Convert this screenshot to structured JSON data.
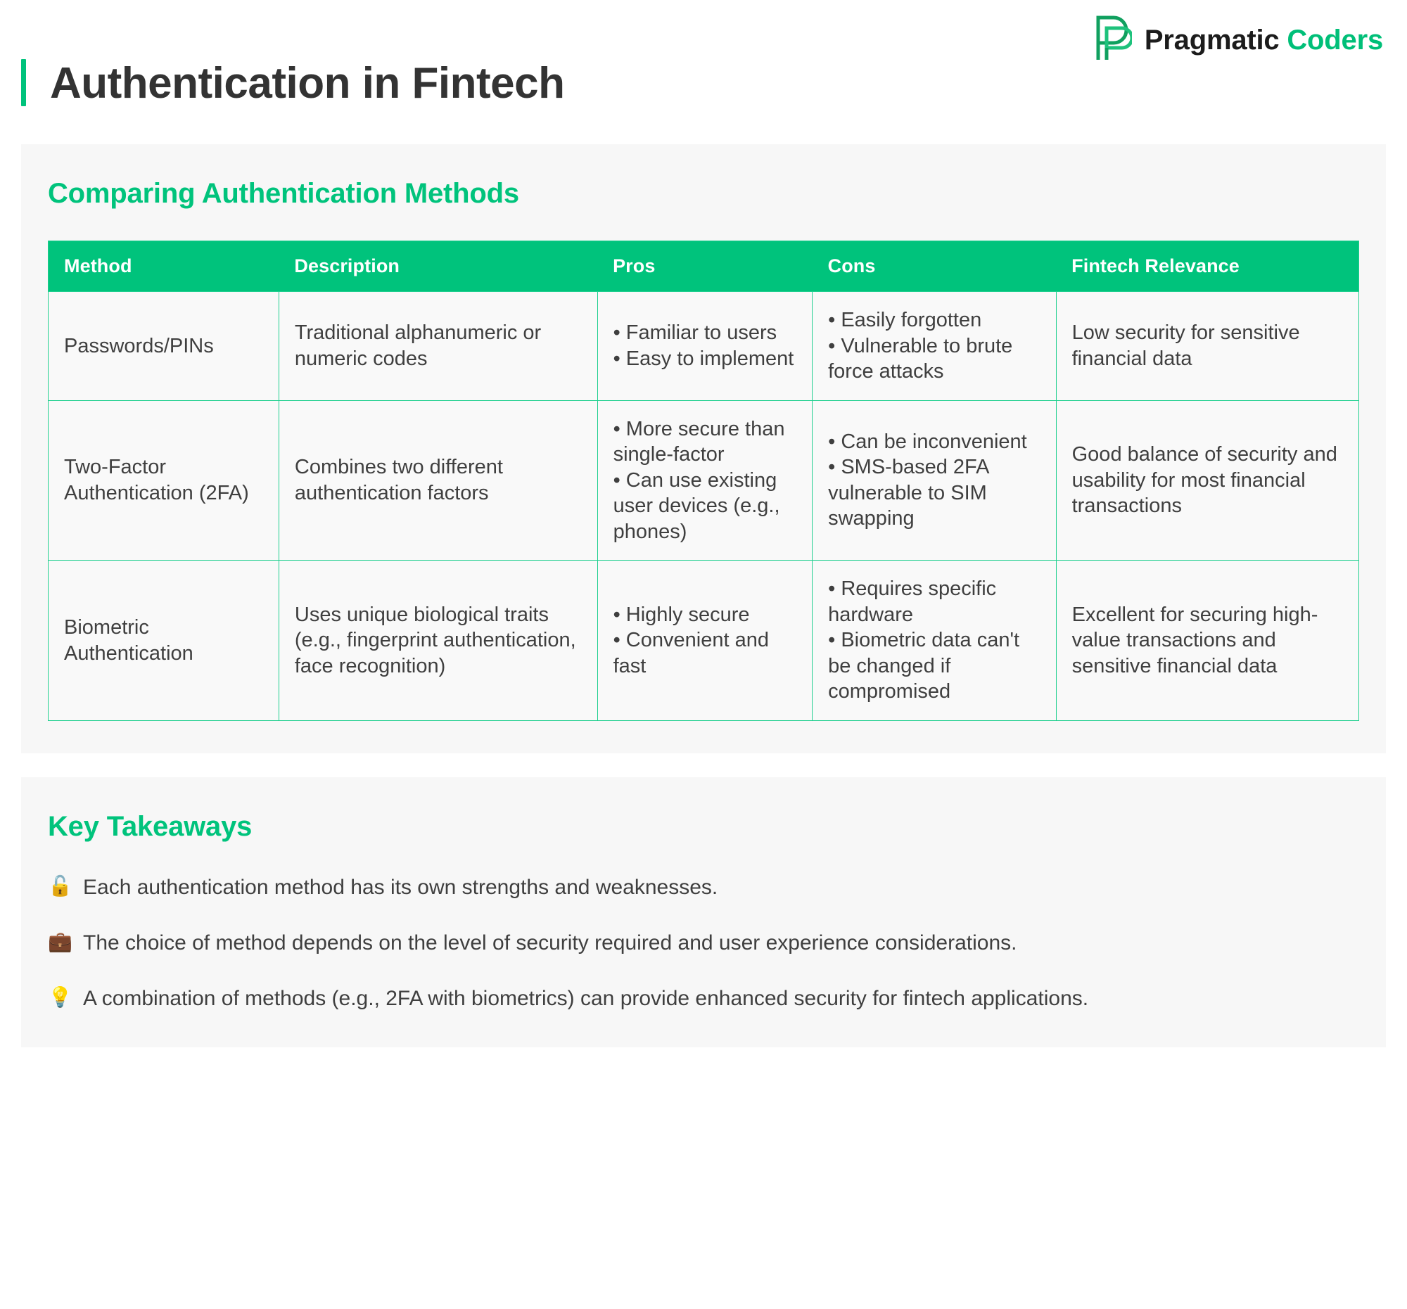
{
  "brand": {
    "logo_icon": "pragmatic-coders-monogram-icon",
    "name_part1": "Pragmatic",
    "name_part2": "Coders",
    "accent_color": "#00bf78",
    "dark_color": "#1c1c1c"
  },
  "header": {
    "title": "Authentication in Fintech",
    "accent_bar_color": "#00c37c"
  },
  "comparison": {
    "heading": "Comparing Authentication Methods",
    "columns": [
      "Method",
      "Description",
      "Pros",
      "Cons",
      "Fintech Relevance"
    ],
    "rows": [
      {
        "method": "Passwords/PINs",
        "description": "Traditional alphanumeric or numeric codes",
        "pros": [
          "Familiar to users",
          "Easy to implement"
        ],
        "cons": [
          "Easily forgotten",
          "Vulnerable to brute force attacks"
        ],
        "relevance": "Low security for sensitive financial data"
      },
      {
        "method": "Two-Factor Authentication (2FA)",
        "description": "Combines two different authentication factors",
        "pros": [
          "More secure than single-factor",
          "Can use existing user devices (e.g., phones)"
        ],
        "cons": [
          "Can be inconvenient",
          "SMS-based 2FA vulnerable to SIM swapping"
        ],
        "relevance": "Good balance of security and usability for most financial transactions"
      },
      {
        "method": "Biometric Authentication",
        "description": "Uses unique biological traits (e.g., fingerprint authentication, face recognition)",
        "pros": [
          "Highly secure",
          "Convenient and fast"
        ],
        "cons": [
          "Requires specific hardware",
          "Biometric data can't be changed if compromised"
        ],
        "relevance": "Excellent for securing high-value transactions and sensitive financial data"
      }
    ],
    "header_bg_color": "#00c37c",
    "border_color": "#1ecf8e"
  },
  "takeaways": {
    "heading": "Key Takeaways",
    "items": [
      {
        "icon": "🔓",
        "icon_name": "open-lock-icon",
        "text": "Each authentication method has its own strengths and weaknesses."
      },
      {
        "icon": "💼",
        "icon_name": "briefcase-icon",
        "text": "The choice of method depends on the level of security required and user experience considerations."
      },
      {
        "icon": "💡",
        "icon_name": "light-bulb-icon",
        "text": "A combination of methods (e.g., 2FA with biometrics) can provide enhanced security for fintech applications."
      }
    ]
  }
}
